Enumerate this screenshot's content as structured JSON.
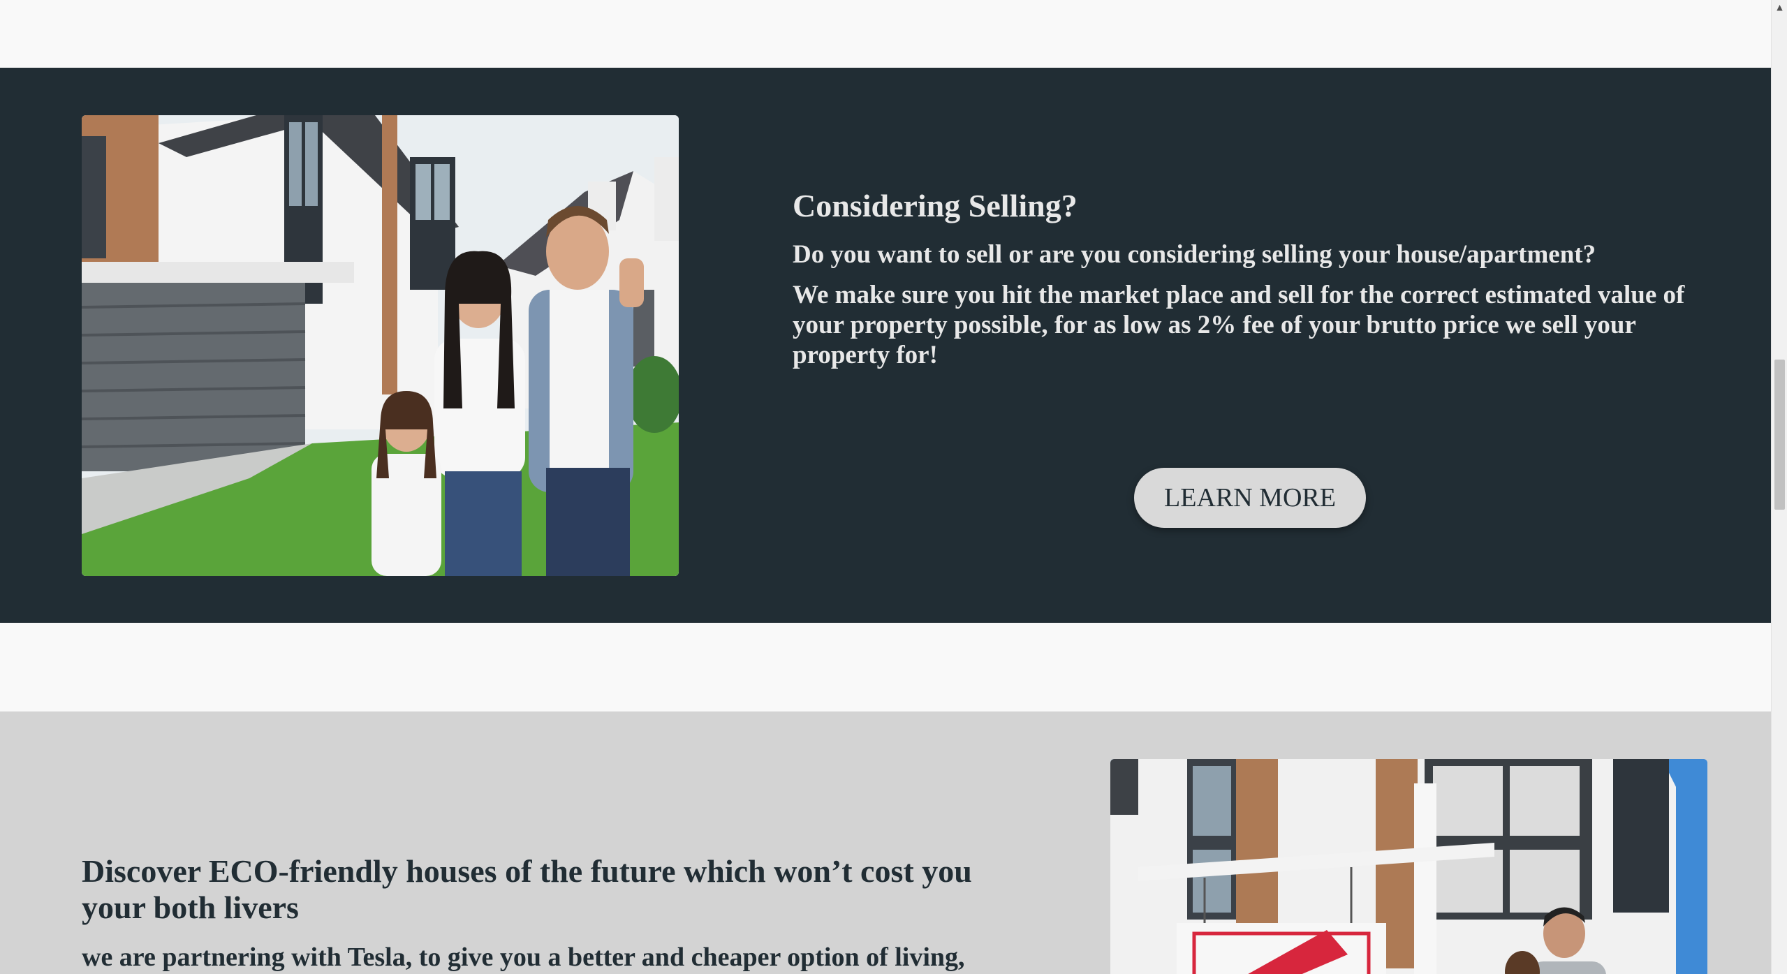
{
  "selling_section": {
    "title": "Considering Selling?",
    "subtitle": "Do you want to sell or are you considering selling your house/apartment?",
    "body": "We make sure you hit the market place and sell for the correct estimated value of your property possible, for as low as 2% fee of your brutto price we sell your property for!",
    "button_label": "LEARN MORE",
    "background_color": "#212d34",
    "button_color": "#d9d9d9"
  },
  "eco_section": {
    "title": "Discover ECO-friendly houses of the future which won’t cost you your both livers",
    "body": "we are partnering with Tesla, to give you a better and cheaper option of living,",
    "background_color": "#d3d3d3"
  },
  "images": {
    "family_photo": "family-with-keys-in-front-of-house",
    "sold_photo": "sold-sign-in-front-of-modern-house"
  }
}
